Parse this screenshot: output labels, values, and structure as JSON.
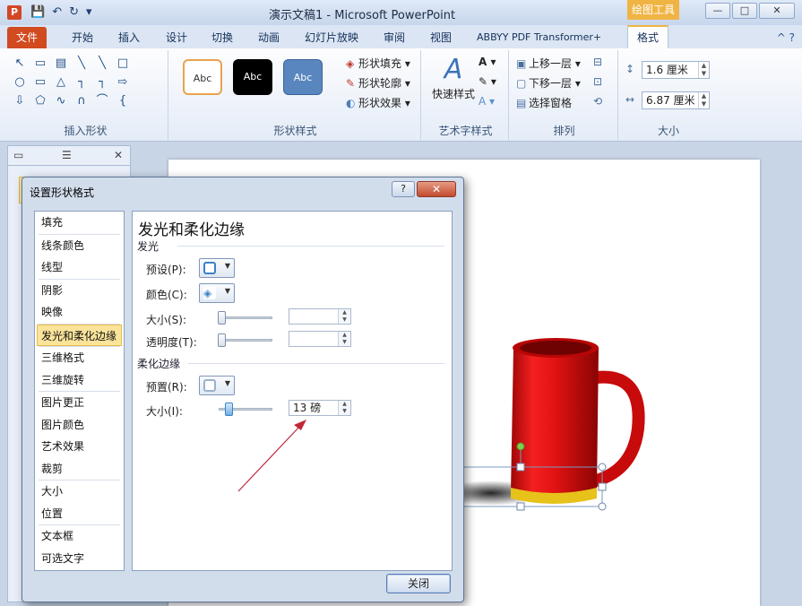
{
  "window": {
    "title": "演示文稿1 - Microsoft PowerPoint",
    "context_tab": "绘图工具",
    "minimize_label": "—",
    "maximize_label": "□",
    "close_label": "✕"
  },
  "qat": {
    "save_icon": "💾",
    "undo_icon": "↶",
    "redo_icon": "↻",
    "custom_icon": "▾"
  },
  "tabs": {
    "file": "文件",
    "items": [
      "开始",
      "插入",
      "设计",
      "切换",
      "动画",
      "幻灯片放映",
      "审阅",
      "视图",
      "ABBYY PDF Transformer+"
    ],
    "active": "格式",
    "right_icons": "^ ?"
  },
  "ribbon": {
    "insert_shapes": {
      "label": "插入形状",
      "shapes": [
        "↖",
        "▭",
        "▤",
        "╲",
        "╲",
        "□",
        "○",
        "▭",
        "△",
        "┐",
        "┐",
        "⇨",
        "⇩",
        "⬠",
        "∿",
        "∩",
        "⌒",
        "{"
      ]
    },
    "shape_styles": {
      "label": "形状样式",
      "sample": "Abc",
      "fill": "形状填充",
      "outline": "形状轮廓",
      "effects": "形状效果"
    },
    "wordart": {
      "label": "艺术字样式",
      "quick_styles": "快速样式"
    },
    "arrange": {
      "label": "排列",
      "bring_forward": "上移一层",
      "send_backward": "下移一层",
      "selection_pane": "选择窗格"
    },
    "size": {
      "label": "大小",
      "height": "1.6 厘米",
      "width": "6.87 厘米"
    }
  },
  "dialog": {
    "title": "设置形状格式",
    "help_label": "?",
    "close_label": "✕",
    "nav": [
      "填充",
      "线条颜色",
      "线型",
      "阴影",
      "映像",
      "发光和柔化边缘",
      "三维格式",
      "三维旋转",
      "图片更正",
      "图片颜色",
      "艺术效果",
      "裁剪",
      "大小",
      "位置",
      "文本框",
      "可选文字"
    ],
    "selected_nav": "发光和柔化边缘",
    "panel_title": "发光和柔化边缘",
    "glow": {
      "section": "发光",
      "preset_label": "预设(P):",
      "color_label": "颜色(C):",
      "size_label": "大小(S):",
      "transparency_label": "透明度(T):",
      "size_value": "",
      "transparency_value": ""
    },
    "soft_edges": {
      "section": "柔化边缘",
      "preset_label": "预置(R):",
      "size_label": "大小(I):",
      "size_value": "13 磅",
      "size_fraction": 0.13
    },
    "close_button": "关闭"
  },
  "colors": {
    "accent_file": "#d14a20",
    "context_tab": "#f0b445",
    "mug_red": "#e01010",
    "mug_gold": "#e6c21a",
    "arrow": "#c0283a"
  }
}
